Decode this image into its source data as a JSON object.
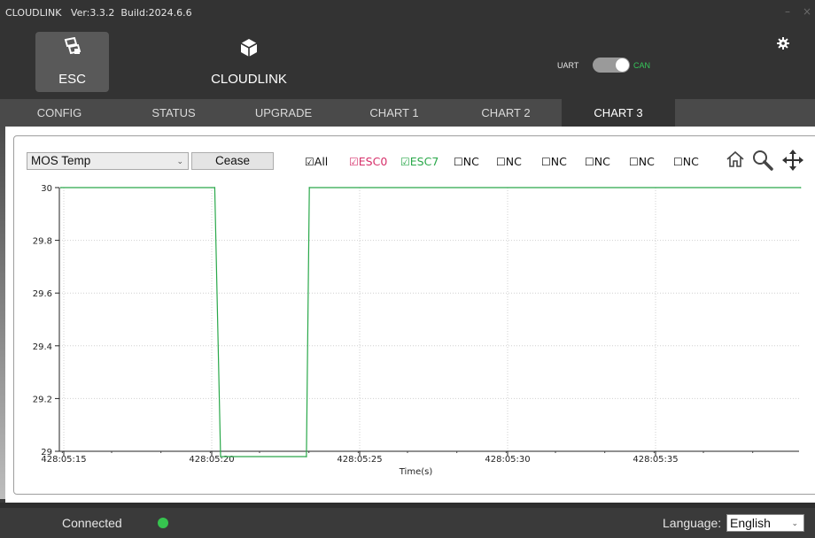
{
  "app": {
    "title": "CLOUDLINK   Ver:3.3.2  Build:2024.6.6",
    "minimize": "–",
    "close": "×"
  },
  "modules": [
    {
      "label": "ESC",
      "icon": "esc-icon",
      "active": true
    },
    {
      "label": "CLOUDLINK",
      "icon": "cube-icon",
      "active": false
    }
  ],
  "mode_toggle": {
    "left_label": "UART",
    "right_label": "CAN",
    "selected": "CAN",
    "on_color": "#35c75a"
  },
  "settings": {
    "icon": "gear-icon"
  },
  "tabs": [
    {
      "label": "CONFIG"
    },
    {
      "label": "STATUS"
    },
    {
      "label": "UPGRADE"
    },
    {
      "label": "CHART 1"
    },
    {
      "label": "CHART 2"
    },
    {
      "label": "CHART 3",
      "active": true
    }
  ],
  "toolbar": {
    "metric_select": {
      "value": "MOS Temp",
      "chevron": "⌄"
    },
    "cease_label": "Cease",
    "checkboxes": [
      {
        "label": "All",
        "checked": true,
        "mark": "☑"
      },
      {
        "label": "ESC0",
        "checked": true,
        "mark": "☑",
        "color": "#d6306a"
      },
      {
        "label": "ESC7",
        "checked": true,
        "mark": "☑",
        "color": "#2aa84a"
      },
      {
        "label": "NC",
        "checked": false,
        "mark": "☐"
      },
      {
        "label": "NC",
        "checked": false,
        "mark": "☐"
      },
      {
        "label": "NC",
        "checked": false,
        "mark": "☐"
      },
      {
        "label": "NC",
        "checked": false,
        "mark": "☐"
      },
      {
        "label": "NC",
        "checked": false,
        "mark": "☐"
      },
      {
        "label": "NC",
        "checked": false,
        "mark": "☐"
      }
    ],
    "tools": [
      "home-icon",
      "zoom-icon",
      "pan-icon"
    ]
  },
  "chart_data": {
    "type": "line",
    "xlabel": "Time(s)",
    "ylabel": "",
    "ylim": [
      29,
      30
    ],
    "y_ticks": [
      "30",
      "29.8",
      "29.6",
      "29.4",
      "29.2",
      "29"
    ],
    "x_ticks": [
      "428:05:15",
      "428:05:20",
      "428:05:25",
      "428:05:30",
      "428:05:35"
    ],
    "grid": true,
    "series": [
      {
        "name": "ESC7",
        "color": "#2aa84a",
        "points": [
          [
            "428:05:14.9",
            30
          ],
          [
            "428:05:20.1",
            30
          ],
          [
            "428:05:20.3",
            28.98
          ],
          [
            "428:05:23.2",
            28.98
          ],
          [
            "428:05:23.3",
            30
          ],
          [
            "428:05:39.9",
            30
          ]
        ]
      }
    ]
  },
  "status": {
    "connection": "Connected",
    "connection_color": "#36c44f",
    "language_label": "Language:",
    "language_value": "English",
    "language_chevron": "⌄"
  }
}
